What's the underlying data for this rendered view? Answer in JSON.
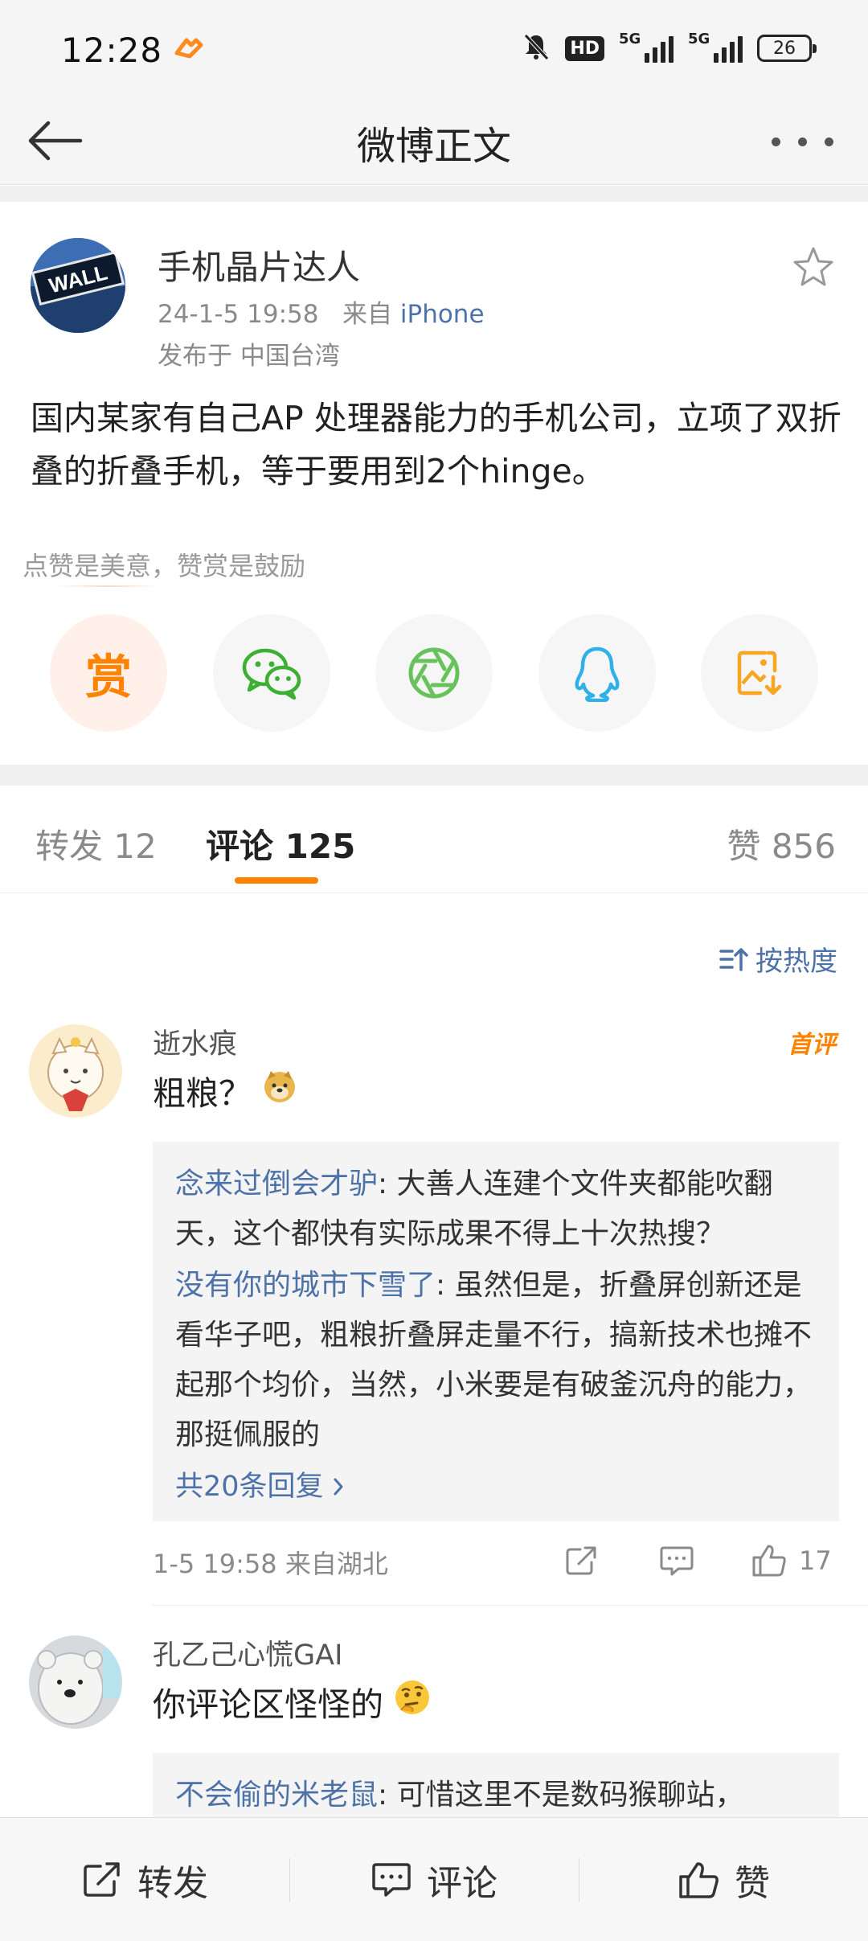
{
  "status_bar": {
    "time": "12:28",
    "hd_label": "HD",
    "signal1_label": "5G",
    "signal2_label": "5G",
    "battery": "26"
  },
  "header": {
    "title": "微博正文"
  },
  "post": {
    "author": "手机晶片达人",
    "datetime": "24-1-5 19:58",
    "source_prefix": "来自",
    "source": "iPhone",
    "location": "发布于 中国台湾",
    "text": "国内某家有自己AP 处理器能力的手机公司，立项了双折叠的折叠手机，等于要用到2个hinge。",
    "reward_hint": "点赞是美意，赞赏是鼓励",
    "reward_label": "赏"
  },
  "tabs": {
    "repost": "转发 12",
    "comment": "评论 125",
    "like": "赞 856"
  },
  "sort": {
    "label": "按热度"
  },
  "comments": [
    {
      "name": "逝水痕",
      "badge": "首评",
      "text": "粗粮？",
      "replies": [
        {
          "user": "念来过倒会才驴",
          "text": ": 大善人连建个文件夹都能吹翻天，这个都快有实际成果不得上十次热搜？"
        },
        {
          "user": "没有你的城市下雪了",
          "text": ": 虽然但是，折叠屏创新还是看华子吧，粗粮折叠屏走量不行，搞新技术也摊不起那个均价，当然，小米要是有破釜沉舟的能力，那挺佩服的"
        }
      ],
      "more_replies": "共20条回复",
      "meta": "1-5 19:58  来自湖北",
      "likes": "17"
    },
    {
      "name": "孔乙己心慌GAI",
      "text": "你评论区怪怪的",
      "replies": [
        {
          "user": "不会偷的米老鼠",
          "text": ": 可惜这里不是数码猴聊站，"
        }
      ]
    }
  ],
  "bottom_bar": {
    "repost": "转发",
    "comment": "评论",
    "like": "赞"
  },
  "colors": {
    "accent": "#ff8200",
    "link": "#4d72a8",
    "wechat": "#3cb035",
    "moments": "#68c25b",
    "qq": "#2fb0e6",
    "save": "#f6a623"
  }
}
